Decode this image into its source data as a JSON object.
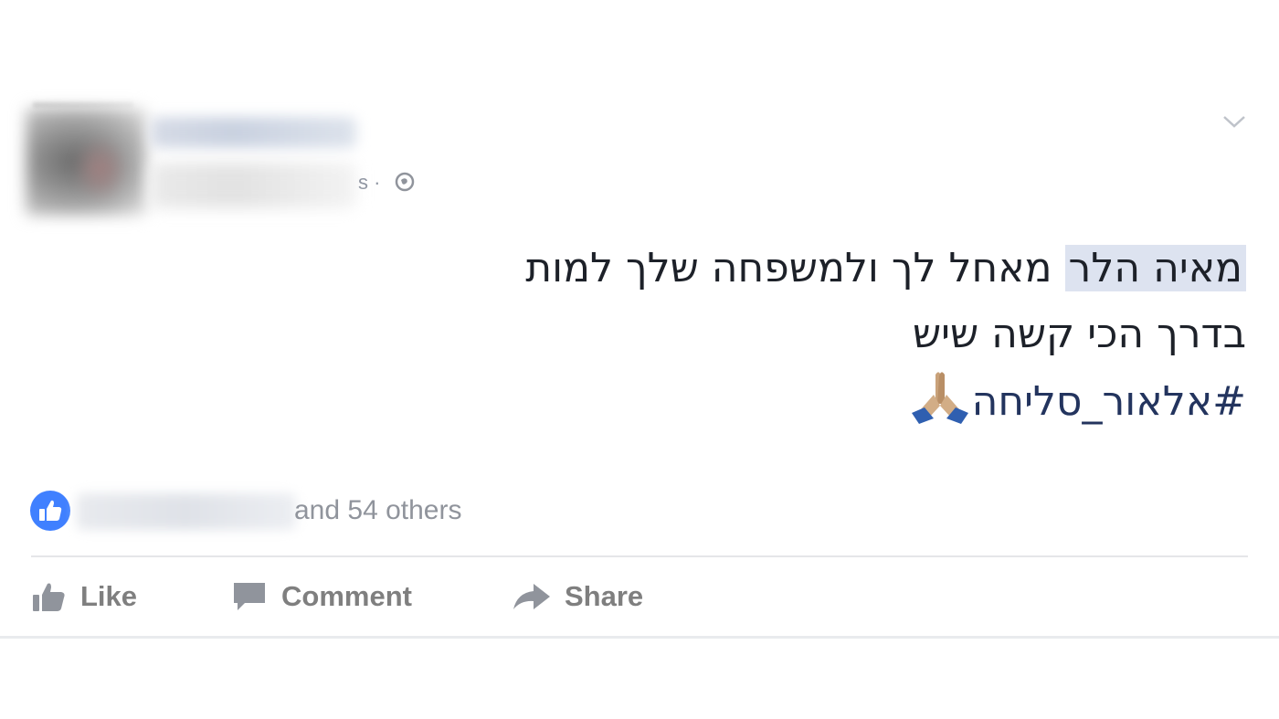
{
  "post": {
    "meta_tail": "s ·",
    "text_lines": [
      "ולמשפחה שלך למות",
      "בדרך הכי קשה שיש"
    ],
    "mention": "מאיה הלר",
    "after_mention": "מאחל לך",
    "hashtag": "#אלאור_סליחה"
  },
  "reactions": {
    "summary_text": "and 54 others"
  },
  "actions": {
    "like_label": "Like",
    "comment_label": "Comment",
    "share_label": "Share"
  },
  "colors": {
    "link_blue": "#4080ff",
    "action_gray": "#7f7f7f",
    "mention_bg": "#dde3f0"
  },
  "icons": [
    "globe-icon",
    "chevron-down-icon",
    "praying-hands-icon",
    "like-badge-icon",
    "thumbs-up-icon",
    "comment-icon",
    "share-icon"
  ]
}
